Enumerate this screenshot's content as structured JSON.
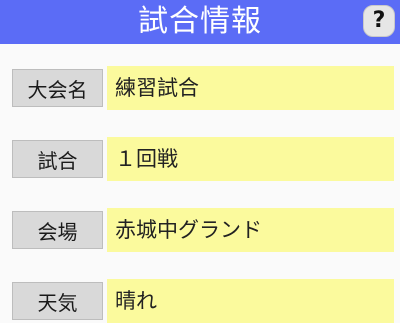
{
  "header": {
    "title": "試合情報",
    "help_label": "?"
  },
  "fields": [
    {
      "label": "大会名",
      "value": "練習試合"
    },
    {
      "label": "試合",
      "value": "１回戦"
    },
    {
      "label": "会場",
      "value": "赤城中グランド"
    },
    {
      "label": "天気",
      "value": "晴れ"
    }
  ],
  "colors": {
    "header_bg": "#5b6cf6",
    "value_bg": "#fbfa9d",
    "label_bg": "#d9d9d9"
  }
}
